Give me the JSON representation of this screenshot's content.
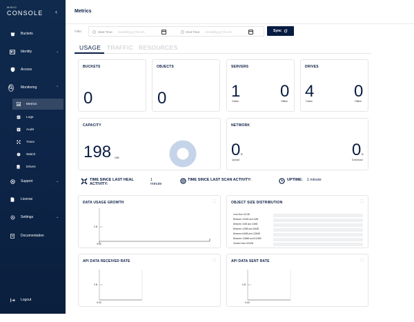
{
  "brand": {
    "sup": "MINIO",
    "name": "CONSOLE"
  },
  "sidebar": {
    "items": [
      {
        "label": "Buckets"
      },
      {
        "label": "Identity"
      },
      {
        "label": "Access"
      },
      {
        "label": "Monitoring"
      },
      {
        "label": "Support"
      },
      {
        "label": "License"
      },
      {
        "label": "Settings"
      },
      {
        "label": "Documentation"
      },
      {
        "label": "Logout"
      }
    ],
    "monitoring_sub": [
      {
        "label": "Metrics"
      },
      {
        "label": "Logs"
      },
      {
        "label": "Audit"
      },
      {
        "label": "Trace"
      },
      {
        "label": "Watch"
      },
      {
        "label": "Drives"
      }
    ]
  },
  "header": {
    "title": "Metrics"
  },
  "filter": {
    "label": "Filter:",
    "start_label": "Start Time:",
    "start_placeholder": "mm/dd/yyyy hh:mm",
    "end_label": "End Time:",
    "end_placeholder": "mm/dd/yyyy hh:mm",
    "sync_label": "Sync"
  },
  "tabs": [
    {
      "label": "USAGE"
    },
    {
      "label": "TRAFFIC"
    },
    {
      "label": "RESOURCES"
    }
  ],
  "cards": {
    "buckets": {
      "title": "BUCKETS",
      "value": "0"
    },
    "objects": {
      "title": "OBJECTS",
      "value": "0"
    },
    "servers": {
      "title": "SERVERS",
      "online": "1",
      "offline": "0",
      "online_label": "Online",
      "offline_label": "Offline"
    },
    "drives": {
      "title": "DRIVES",
      "online": "4",
      "offline": "0",
      "online_label": "Online",
      "offline_label": "Offline"
    },
    "capacity": {
      "title": "CAPACITY",
      "value": "198",
      "unit": "GiB"
    },
    "network": {
      "title": "NETWORK",
      "upload": "0",
      "upload_unit": "B",
      "upload_label": "Upload",
      "download": "0",
      "download_unit": "B",
      "download_label": "Download"
    }
  },
  "stats": {
    "heal_label_1": "TIME SINCE LAST HEAL",
    "heal_label_2": "ACTIVITY:",
    "heal_value_1": "1",
    "heal_value_2": "minute",
    "scan_label": "TIME SINCE LAST SCAN ACTIVITY:",
    "uptime_label": "UPTIME:",
    "uptime_value": "1 minute"
  },
  "charts": {
    "data_usage": {
      "title": "DATA USAGE GROWTH",
      "ytick": "0 B",
      "xtick": "9:00"
    },
    "object_size": {
      "title": "OBJECT SIZE DISTRIBUTION",
      "rows": [
        "Less than 1024B",
        "Between 1024B and 1MB",
        "Between 1MB and 10MB",
        "Between 10MB and 64MB",
        "Between 64MB and 128MB",
        "Between 128MB and 512MB",
        "Greater than 512MB"
      ]
    },
    "api_received": {
      "title": "API DATA RECEIVED RATE",
      "ytick": "0 B",
      "xtick": "9:00"
    },
    "api_sent": {
      "title": "API DATA SENT RATE",
      "ytick": "0 B",
      "xtick": "9:00"
    }
  },
  "colors": {
    "sidebar_bg": "#0f2a4d",
    "accent": "#081c42",
    "donut": "#c5d4e8"
  }
}
